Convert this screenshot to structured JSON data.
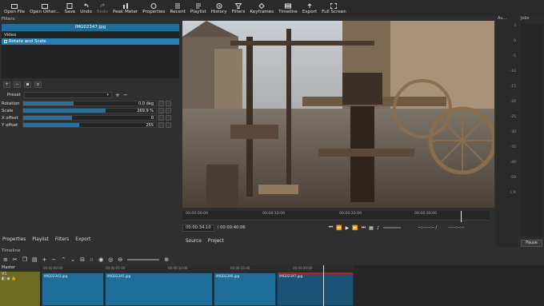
{
  "toolbar": {
    "items": [
      {
        "label": "Open File",
        "icon": "open-file-icon"
      },
      {
        "label": "Open Other...",
        "icon": "open-other-icon"
      },
      {
        "label": "Save",
        "icon": "save-icon"
      },
      {
        "label": "Undo",
        "icon": "undo-icon"
      },
      {
        "label": "Redo",
        "icon": "redo-icon"
      },
      {
        "label": "Peak Meter",
        "icon": "peak-meter-icon"
      },
      {
        "label": "Properties",
        "icon": "properties-icon"
      },
      {
        "label": "Recent",
        "icon": "recent-icon"
      },
      {
        "label": "Playlist",
        "icon": "playlist-icon"
      },
      {
        "label": "History",
        "icon": "history-icon"
      },
      {
        "label": "Filters",
        "icon": "filters-icon"
      },
      {
        "label": "Keyframes",
        "icon": "keyframes-icon"
      },
      {
        "label": "Timeline",
        "icon": "timeline-icon"
      },
      {
        "label": "Export",
        "icon": "export-icon"
      },
      {
        "label": "Full Screen",
        "icon": "full-screen-icon"
      }
    ]
  },
  "filters": {
    "panel_title": "Filters",
    "filename": "IMG02347.jpg",
    "group_label": "Video",
    "active_filter": "Rotate and Scale",
    "preset_label": "Preset",
    "params": [
      {
        "label": "Rotation",
        "value": "0.0 deg",
        "level": 0.38
      },
      {
        "label": "Scale",
        "value": "269.9 %",
        "level": 0.62
      },
      {
        "label": "X offset",
        "value": "0",
        "level": 0.37
      },
      {
        "label": "Y offset",
        "value": "255",
        "level": 0.42
      }
    ]
  },
  "left_tabs": [
    "Properties",
    "Playlist",
    "Filters",
    "Export"
  ],
  "player": {
    "ruler_ticks": [
      "00:00:00:00",
      "00:00:10:00",
      "00:00:20:00",
      "00:00:30:00"
    ],
    "position": "00:00:34:10",
    "duration": "/ 00:00:40:06",
    "in_point": "--:--:--:-- /",
    "out_point": "--:--:--:--",
    "tabs": [
      "Source",
      "Project"
    ]
  },
  "meter": {
    "title": "Au...",
    "scale": [
      "3",
      "0",
      "-5",
      "-10",
      "-15",
      "-20",
      "-25",
      "-30",
      "-35",
      "-40",
      "-50",
      "L R"
    ]
  },
  "jobs": {
    "title": "Jobs",
    "pause_label": "Pause"
  },
  "timeline": {
    "title": "Timeline",
    "master_label": "Master",
    "track_label": "V1",
    "ruler": [
      "00:00:00:00",
      "00:00:05:00",
      "00:00:10:00",
      "00:00:15:00",
      "00:00:20:00",
      "00:00:25:00"
    ],
    "clips": [
      {
        "name": "IMG02343.jpg"
      },
      {
        "name": "IMG02345.jpg"
      },
      {
        "name": "IMG02346.jpg"
      },
      {
        "name": "IMG02347.jpg"
      }
    ]
  },
  "colors": {
    "accent": "#2a7fb0",
    "track_header": "#6b6b22",
    "selection": "#c01e1e"
  }
}
